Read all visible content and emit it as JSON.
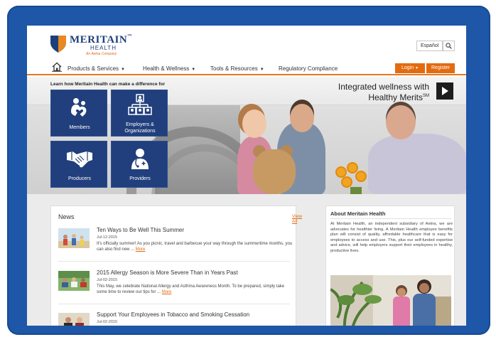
{
  "brand": {
    "name": "MERITAIN",
    "tm": "™",
    "sub": "HEALTH",
    "tagline": "An Aetna Company",
    "colors": {
      "navy": "#1f3f7a",
      "orange": "#e26b12",
      "frame_blue": "#1e56a8"
    }
  },
  "utility": {
    "language_label": "Español",
    "search_icon": "search-icon"
  },
  "nav": {
    "home_icon": "home-icon",
    "items": [
      {
        "label": "Products & Services",
        "caret": "▼"
      },
      {
        "label": "Health & Wellness",
        "caret": "▼"
      },
      {
        "label": "Tools & Resources",
        "caret": "▼"
      },
      {
        "label": "Regulatory Compliance",
        "caret": ""
      }
    ],
    "login_label": "Login",
    "login_caret": "▼",
    "register_label": "Register"
  },
  "hero": {
    "caption": "Learn how Meritain Health can make a difference for",
    "headline_line1": "Integrated wellness with",
    "headline_line2": "Healthy Merits",
    "headline_sup": "SM",
    "play_icon": "play-icon",
    "tiles": [
      {
        "label": "Members",
        "icon": "members-icon"
      },
      {
        "label_line1": "Employers &",
        "label_line2": "Organizations",
        "icon": "org-chart-icon"
      },
      {
        "label": "Producers",
        "icon": "handshake-icon"
      },
      {
        "label": "Providers",
        "icon": "doctor-icon"
      }
    ],
    "slider": {
      "slides": 4,
      "active": 1
    }
  },
  "news": {
    "title": "News",
    "view_all": "View All",
    "more_label": "More",
    "items": [
      {
        "headline": "Ten Ways to Be Well This Summer",
        "date": "Jul-12-2015",
        "text": "It's officially summer! As you picnic, travel and barbecue your way through the summertime months, you can also find new ..."
      },
      {
        "headline": "2015 Allergy Season is More Severe Than in Years Past",
        "date": "Jul-02-2015",
        "text": "This May, we celebrate National Allergy and Asthma Awareness Month. To be prepared, simply take some time to review our tips for ..."
      },
      {
        "headline": "Support Your Employees in Tobacco and Smoking Cessation",
        "date": "Jul-02-2015",
        "text": ""
      }
    ]
  },
  "about": {
    "title": "About Meritain Health",
    "text": "At Meritain Health, an independent subsidiary of Aetna, we are advocates for healthier living. A Meritain Health employee benefits plan will consist of quality, affordable healthcare that is easy for employees to access and use. This, plus our self-funded expertise and advice, will help employers support their employees in healthy, productive lives."
  }
}
